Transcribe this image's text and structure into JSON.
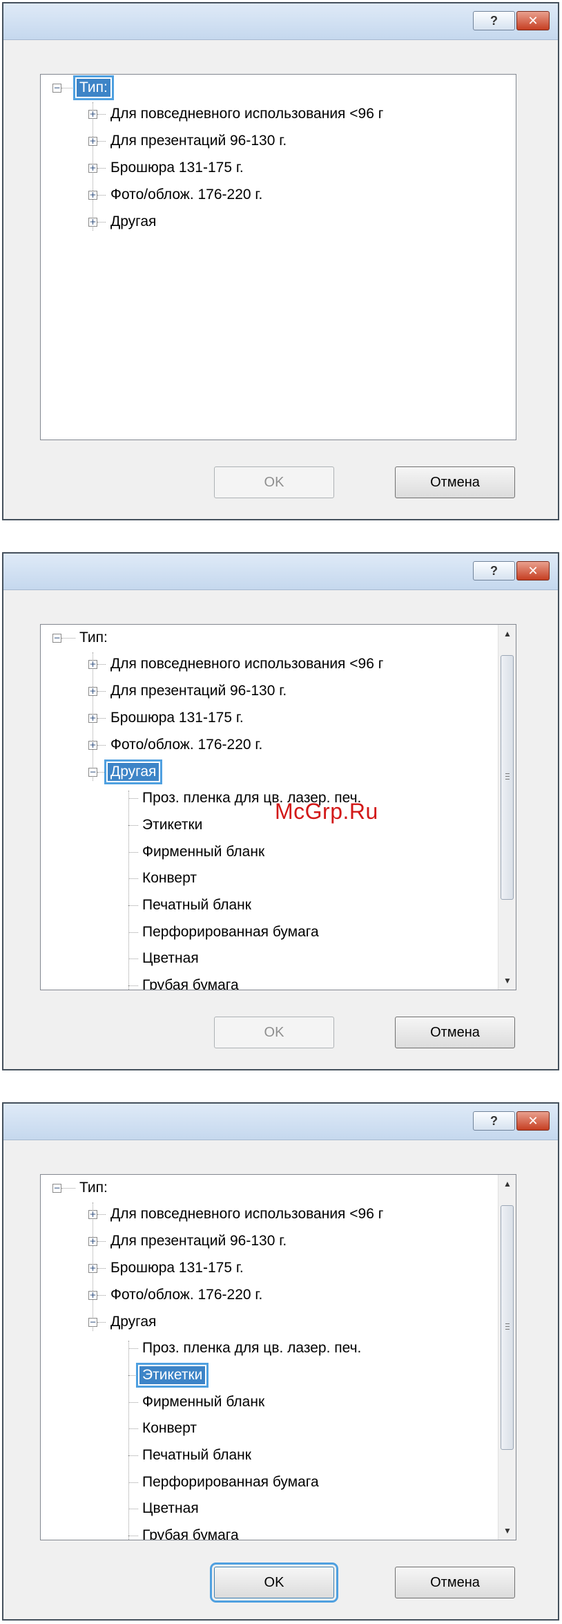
{
  "dialogs": [
    {
      "help_label": "?",
      "close_label": "✕",
      "root_label": "Тип:",
      "items": [
        "Для повседневного использования <96 г",
        "Для презентаций 96-130 г.",
        "Брошюра 131-175 г.",
        "Фото/облож. 176-220 г.",
        "Другая"
      ],
      "children": [],
      "ok_label": "OK",
      "cancel_label": "Отмена"
    },
    {
      "help_label": "?",
      "close_label": "✕",
      "root_label": "Тип:",
      "items": [
        "Для повседневного использования <96 г",
        "Для презентаций 96-130 г.",
        "Брошюра 131-175 г.",
        "Фото/облож. 176-220 г.",
        "Другая"
      ],
      "children": [
        "Проз. пленка для цв. лазер. печ.",
        "Этикетки",
        "Фирменный бланк",
        "Конверт",
        "Печатный бланк",
        "Перфорированная бумага",
        "Цветная",
        "Грубая бумага"
      ],
      "ok_label": "OK",
      "cancel_label": "Отмена"
    },
    {
      "help_label": "?",
      "close_label": "✕",
      "root_label": "Тип:",
      "items": [
        "Для повседневного использования <96 г",
        "Для презентаций 96-130 г.",
        "Брошюра 131-175 г.",
        "Фото/облож. 176-220 г.",
        "Другая"
      ],
      "children": [
        "Проз. пленка для цв. лазер. печ.",
        "Этикетки",
        "Фирменный бланк",
        "Конверт",
        "Печатный бланк",
        "Перфорированная бумага",
        "Цветная",
        "Грубая бумага"
      ],
      "ok_label": "OK",
      "cancel_label": "Отмена"
    }
  ],
  "watermark": "McGrp.Ru",
  "colors": {
    "selection": "#3d84c7",
    "focus_ring": "#4fa0e0",
    "watermark": "#d21818"
  }
}
